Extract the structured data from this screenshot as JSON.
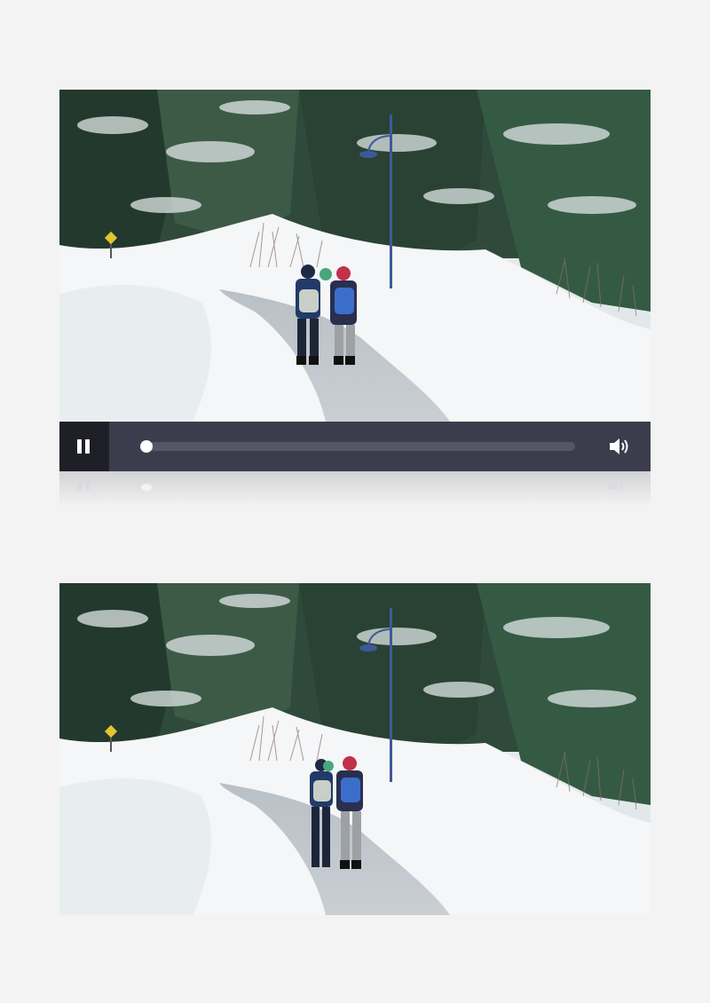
{
  "scene": {
    "description_icon": "snowy-forest-path-with-two-hikers"
  },
  "player": {
    "state": "playing",
    "control_icon": "pause-icon",
    "volume_icon": "volume-icon",
    "progress_fraction": 0.0
  },
  "colors": {
    "page_background": "#f3f3f3",
    "control_bar": "#3b3d4c",
    "pause_button_bg": "#1f2027",
    "progress_track": "#555769",
    "knob": "#ffffff"
  }
}
